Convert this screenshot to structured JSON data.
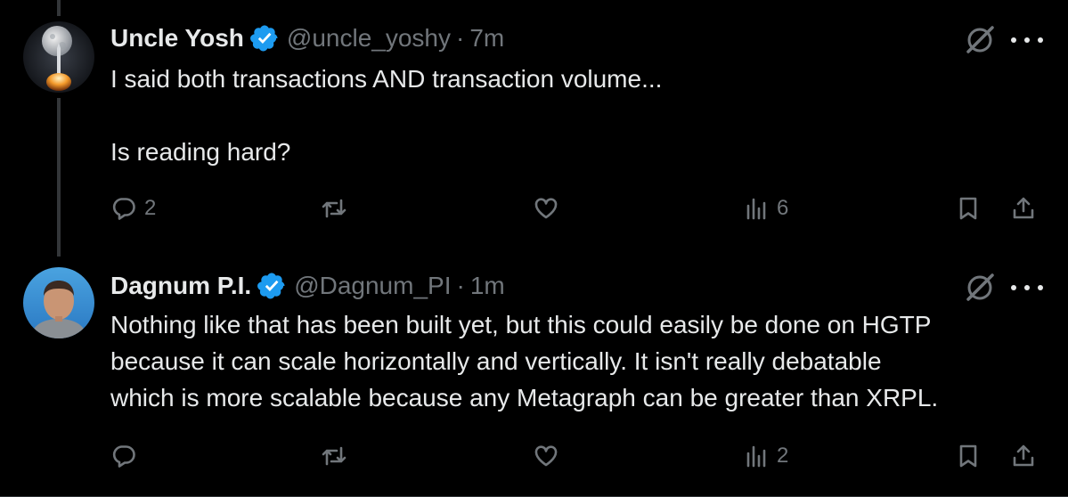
{
  "tweets": [
    {
      "display_name": "Uncle Yosh",
      "handle": "@uncle_yoshy",
      "separator": "·",
      "time": "7m",
      "text_lines": [
        "I said both transactions AND transaction volume...",
        "",
        "Is reading hard?"
      ],
      "replies": "2",
      "retweets": "",
      "likes": "",
      "views": "6",
      "avatar_icon": "avatar-moon-rocket-icon"
    },
    {
      "display_name": "Dagnum P.I.",
      "handle": "@Dagnum_PI",
      "separator": "·",
      "time": "1m",
      "text_lines": [
        "Nothing like that has been built yet, but this could easily be done on HGTP",
        "because it can scale horizontally and vertically. It isn't really debatable",
        "which is more scalable because any Metagraph can be greater than XRPL."
      ],
      "replies": "",
      "retweets": "",
      "likes": "",
      "views": "2",
      "avatar_icon": "avatar-portrait-icon"
    }
  ],
  "colors": {
    "background": "#000000",
    "text": "#e7e9ea",
    "muted": "#71767b",
    "verified": "#1d9bf0",
    "thread_line": "#333639"
  }
}
